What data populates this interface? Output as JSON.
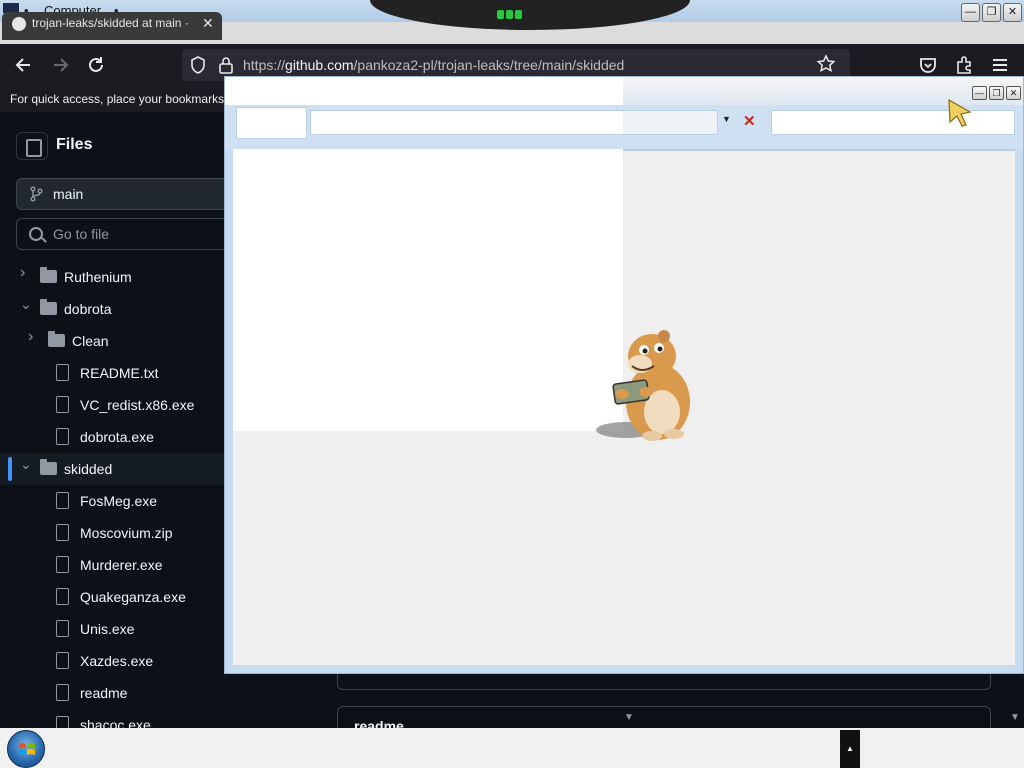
{
  "os": {
    "title": "Computer",
    "dot": "•",
    "min": "—",
    "restore": "❐",
    "close": "✕"
  },
  "browser": {
    "tab_title": "trojan-leaks/skidded at main ·",
    "tab_close": "✕",
    "url_prefix": "https://",
    "url_host": "github.com",
    "url_path": "/pankoza2-pl/trojan-leaks/tree/main/skidded",
    "bookmarks_text": "For quick access, place your bookmarks h"
  },
  "github": {
    "files_title": "Files",
    "branch": "main",
    "goto_placeholder": "Go to file",
    "tree": [
      {
        "label": "Ruthenium",
        "kind": "folder",
        "state": "collapsed"
      },
      {
        "label": "dobrota",
        "kind": "folder",
        "state": "expanded"
      },
      {
        "label": "Clean",
        "kind": "folder",
        "state": "collapsed"
      },
      {
        "label": "README.txt",
        "kind": "file"
      },
      {
        "label": "VC_redist.x86.exe",
        "kind": "file"
      },
      {
        "label": "dobrota.exe",
        "kind": "file"
      },
      {
        "label": "skidded",
        "kind": "folder",
        "state": "expanded",
        "selected": true
      },
      {
        "label": "FosMeg.exe",
        "kind": "file"
      },
      {
        "label": "Moscovium.zip",
        "kind": "file"
      },
      {
        "label": "Murderer.exe",
        "kind": "file"
      },
      {
        "label": "Quakeganza.exe",
        "kind": "file"
      },
      {
        "label": "Unis.exe",
        "kind": "file"
      },
      {
        "label": "Xazdes.exe",
        "kind": "file"
      },
      {
        "label": "readme",
        "kind": "file"
      },
      {
        "label": "shacoc.exe",
        "kind": "file"
      }
    ],
    "readme_heading": "readme"
  },
  "overlay": {
    "dropdown_glyph": "▼",
    "clear_glyph": "✕",
    "min": "—",
    "restore": "❐",
    "close": "✕"
  },
  "taskbar": {
    "tray_glyph": "▲"
  },
  "colors": {
    "accent": "#4493f8",
    "overlay_frame": "#c6dcf0",
    "clear_x": "#c42b1c"
  }
}
